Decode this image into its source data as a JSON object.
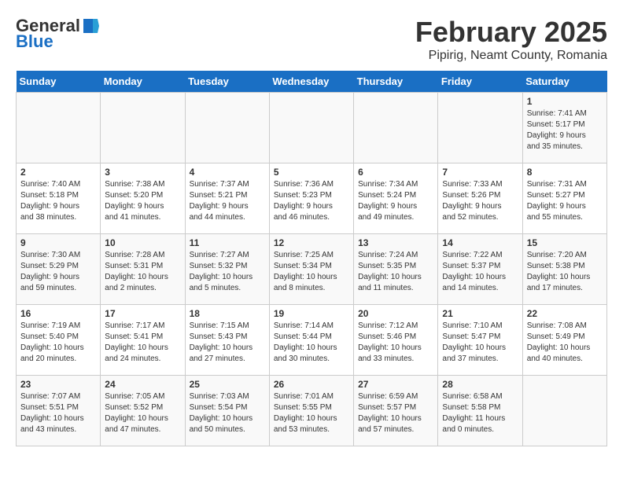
{
  "header": {
    "logo_general": "General",
    "logo_blue": "Blue",
    "month": "February 2025",
    "location": "Pipirig, Neamt County, Romania"
  },
  "days_of_week": [
    "Sunday",
    "Monday",
    "Tuesday",
    "Wednesday",
    "Thursday",
    "Friday",
    "Saturday"
  ],
  "weeks": [
    [
      {
        "day": "",
        "info": ""
      },
      {
        "day": "",
        "info": ""
      },
      {
        "day": "",
        "info": ""
      },
      {
        "day": "",
        "info": ""
      },
      {
        "day": "",
        "info": ""
      },
      {
        "day": "",
        "info": ""
      },
      {
        "day": "1",
        "info": "Sunrise: 7:41 AM\nSunset: 5:17 PM\nDaylight: 9 hours\nand 35 minutes."
      }
    ],
    [
      {
        "day": "2",
        "info": "Sunrise: 7:40 AM\nSunset: 5:18 PM\nDaylight: 9 hours\nand 38 minutes."
      },
      {
        "day": "3",
        "info": "Sunrise: 7:38 AM\nSunset: 5:20 PM\nDaylight: 9 hours\nand 41 minutes."
      },
      {
        "day": "4",
        "info": "Sunrise: 7:37 AM\nSunset: 5:21 PM\nDaylight: 9 hours\nand 44 minutes."
      },
      {
        "day": "5",
        "info": "Sunrise: 7:36 AM\nSunset: 5:23 PM\nDaylight: 9 hours\nand 46 minutes."
      },
      {
        "day": "6",
        "info": "Sunrise: 7:34 AM\nSunset: 5:24 PM\nDaylight: 9 hours\nand 49 minutes."
      },
      {
        "day": "7",
        "info": "Sunrise: 7:33 AM\nSunset: 5:26 PM\nDaylight: 9 hours\nand 52 minutes."
      },
      {
        "day": "8",
        "info": "Sunrise: 7:31 AM\nSunset: 5:27 PM\nDaylight: 9 hours\nand 55 minutes."
      }
    ],
    [
      {
        "day": "9",
        "info": "Sunrise: 7:30 AM\nSunset: 5:29 PM\nDaylight: 9 hours\nand 59 minutes."
      },
      {
        "day": "10",
        "info": "Sunrise: 7:28 AM\nSunset: 5:31 PM\nDaylight: 10 hours\nand 2 minutes."
      },
      {
        "day": "11",
        "info": "Sunrise: 7:27 AM\nSunset: 5:32 PM\nDaylight: 10 hours\nand 5 minutes."
      },
      {
        "day": "12",
        "info": "Sunrise: 7:25 AM\nSunset: 5:34 PM\nDaylight: 10 hours\nand 8 minutes."
      },
      {
        "day": "13",
        "info": "Sunrise: 7:24 AM\nSunset: 5:35 PM\nDaylight: 10 hours\nand 11 minutes."
      },
      {
        "day": "14",
        "info": "Sunrise: 7:22 AM\nSunset: 5:37 PM\nDaylight: 10 hours\nand 14 minutes."
      },
      {
        "day": "15",
        "info": "Sunrise: 7:20 AM\nSunset: 5:38 PM\nDaylight: 10 hours\nand 17 minutes."
      }
    ],
    [
      {
        "day": "16",
        "info": "Sunrise: 7:19 AM\nSunset: 5:40 PM\nDaylight: 10 hours\nand 20 minutes."
      },
      {
        "day": "17",
        "info": "Sunrise: 7:17 AM\nSunset: 5:41 PM\nDaylight: 10 hours\nand 24 minutes."
      },
      {
        "day": "18",
        "info": "Sunrise: 7:15 AM\nSunset: 5:43 PM\nDaylight: 10 hours\nand 27 minutes."
      },
      {
        "day": "19",
        "info": "Sunrise: 7:14 AM\nSunset: 5:44 PM\nDaylight: 10 hours\nand 30 minutes."
      },
      {
        "day": "20",
        "info": "Sunrise: 7:12 AM\nSunset: 5:46 PM\nDaylight: 10 hours\nand 33 minutes."
      },
      {
        "day": "21",
        "info": "Sunrise: 7:10 AM\nSunset: 5:47 PM\nDaylight: 10 hours\nand 37 minutes."
      },
      {
        "day": "22",
        "info": "Sunrise: 7:08 AM\nSunset: 5:49 PM\nDaylight: 10 hours\nand 40 minutes."
      }
    ],
    [
      {
        "day": "23",
        "info": "Sunrise: 7:07 AM\nSunset: 5:51 PM\nDaylight: 10 hours\nand 43 minutes."
      },
      {
        "day": "24",
        "info": "Sunrise: 7:05 AM\nSunset: 5:52 PM\nDaylight: 10 hours\nand 47 minutes."
      },
      {
        "day": "25",
        "info": "Sunrise: 7:03 AM\nSunset: 5:54 PM\nDaylight: 10 hours\nand 50 minutes."
      },
      {
        "day": "26",
        "info": "Sunrise: 7:01 AM\nSunset: 5:55 PM\nDaylight: 10 hours\nand 53 minutes."
      },
      {
        "day": "27",
        "info": "Sunrise: 6:59 AM\nSunset: 5:57 PM\nDaylight: 10 hours\nand 57 minutes."
      },
      {
        "day": "28",
        "info": "Sunrise: 6:58 AM\nSunset: 5:58 PM\nDaylight: 11 hours\nand 0 minutes."
      },
      {
        "day": "",
        "info": ""
      }
    ]
  ]
}
